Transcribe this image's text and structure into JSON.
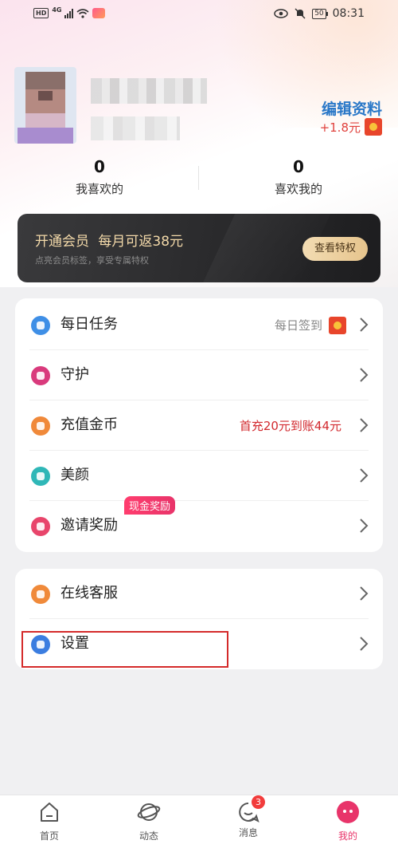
{
  "status_bar": {
    "hd": "HD",
    "network": "4G",
    "battery": "50",
    "time": "08:31"
  },
  "profile": {
    "edit_label": "编辑资料",
    "reward": "+1.8元"
  },
  "stats": [
    {
      "value": "0",
      "label": "我喜欢的"
    },
    {
      "value": "0",
      "label": "喜欢我的"
    }
  ],
  "vip": {
    "title": "开通会员",
    "promo": "每月可返38元",
    "subtitle": "点亮会员标签，享受专属特权",
    "button": "查看特权"
  },
  "menu_main": [
    {
      "label": "每日任务",
      "right_text": "每日签到",
      "icon": "calendar-icon",
      "color": "#3f8fe6"
    },
    {
      "label": "守护",
      "right_text": "",
      "icon": "shield-icon",
      "color": "#d93a7c"
    },
    {
      "label": "充值金币",
      "right_text": "首充20元到账44元",
      "icon": "coin-icon",
      "color": "#f0893a"
    },
    {
      "label": "美颜",
      "right_text": "",
      "icon": "beauty-icon",
      "color": "#2fb7b7"
    },
    {
      "label": "邀请奖励",
      "right_text": "",
      "tag": "现金奖励",
      "icon": "gift-icon",
      "color": "#e8456b"
    }
  ],
  "menu_secondary": [
    {
      "label": "在线客服",
      "icon": "service-icon",
      "color": "#f08a3a"
    },
    {
      "label": "设置",
      "icon": "settings-icon",
      "color": "#3b7de0"
    }
  ],
  "bottom_nav": [
    {
      "label": "首页",
      "icon": "home-icon",
      "active": false
    },
    {
      "label": "动态",
      "icon": "planet-icon",
      "active": false
    },
    {
      "label": "消息",
      "icon": "message-icon",
      "active": false,
      "badge": "3"
    },
    {
      "label": "我的",
      "icon": "profile-icon",
      "active": true
    }
  ],
  "colors": {
    "accent": "#e8346a",
    "link": "#2a78c8",
    "promo_red": "#d2292e"
  }
}
